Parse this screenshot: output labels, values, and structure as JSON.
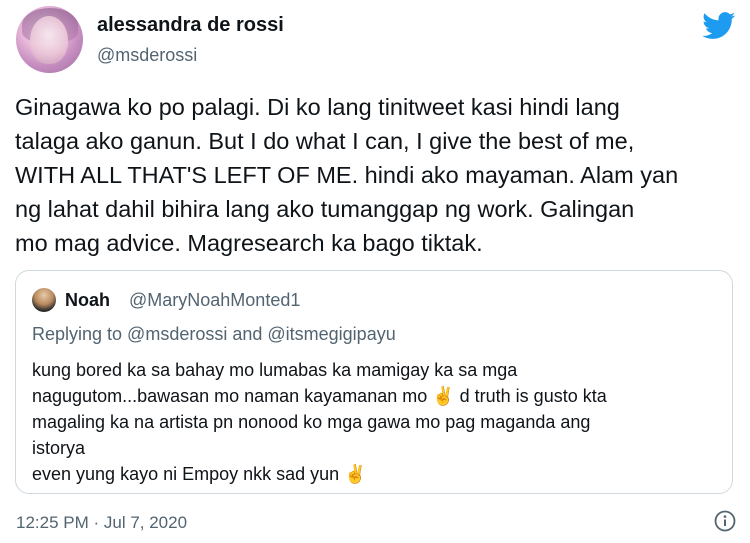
{
  "author": {
    "display_name": "alessandra de rossi",
    "handle": "@msderossi"
  },
  "tweet_text": "Ginagawa ko po palagi. Di ko lang tinitweet kasi hindi lang\ntalaga ako ganun. But I do what I can, I give the best of me,\nWITH ALL THAT'S LEFT OF ME. hindi ako mayaman. Alam yan\nng lahat dahil bihira lang ako tumanggap ng work. Galingan\nmo mag advice. Magresearch ka bago tiktak.",
  "quoted_tweet": {
    "display_name": "Noah",
    "handle": "@MaryNoahMonted1",
    "replying_to": "Replying to @msderossi and @itsmegigipayu",
    "text": "kung bored ka sa bahay mo lumabas ka mamigay ka sa mga\nnagugutom...bawasan mo naman kayamanan mo ✌️ d truth is gusto kta\nmagaling ka na artista pn nonood ko mga gawa mo pag maganda ang\nistorya\neven yung kayo ni Empoy nkk sad yun ✌️"
  },
  "timestamp": "12:25 PM · Jul 7, 2020",
  "icons": {
    "brand": "twitter-bird-icon",
    "info": "info-icon"
  },
  "colors": {
    "brand_blue": "#1d9bf0",
    "secondary_text": "#536471",
    "border": "#cfd9de"
  }
}
